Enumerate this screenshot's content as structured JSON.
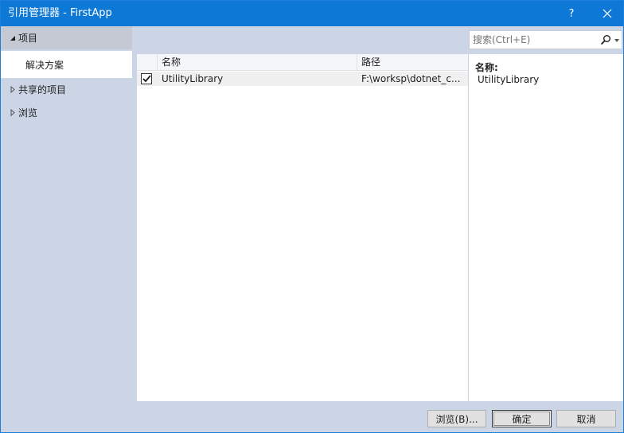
{
  "window": {
    "title": "引用管理器 - FirstApp",
    "help_label": "?"
  },
  "nav": {
    "project": {
      "label": "项目",
      "expanded": true
    },
    "solution": {
      "label": "解决方案"
    },
    "shared": {
      "label": "共享的项目",
      "expanded": false
    },
    "browse": {
      "label": "浏览",
      "expanded": false
    }
  },
  "search": {
    "placeholder": "搜索(Ctrl+E)"
  },
  "grid": {
    "columns": {
      "name": "名称",
      "path": "路径"
    },
    "rows": [
      {
        "checked": true,
        "name": "UtilityLibrary",
        "path": "F:\\worksp\\dotnet_c..."
      }
    ]
  },
  "details": {
    "name_label": "名称:",
    "name_value": "UtilityLibrary"
  },
  "footer": {
    "browse_label": "浏览(B)...",
    "ok_label": "确定",
    "cancel_label": "取消"
  },
  "colors": {
    "titlebar": "#0e78d6",
    "pane_background": "#ccd5e6",
    "selected_group": "#c4c9d3"
  }
}
